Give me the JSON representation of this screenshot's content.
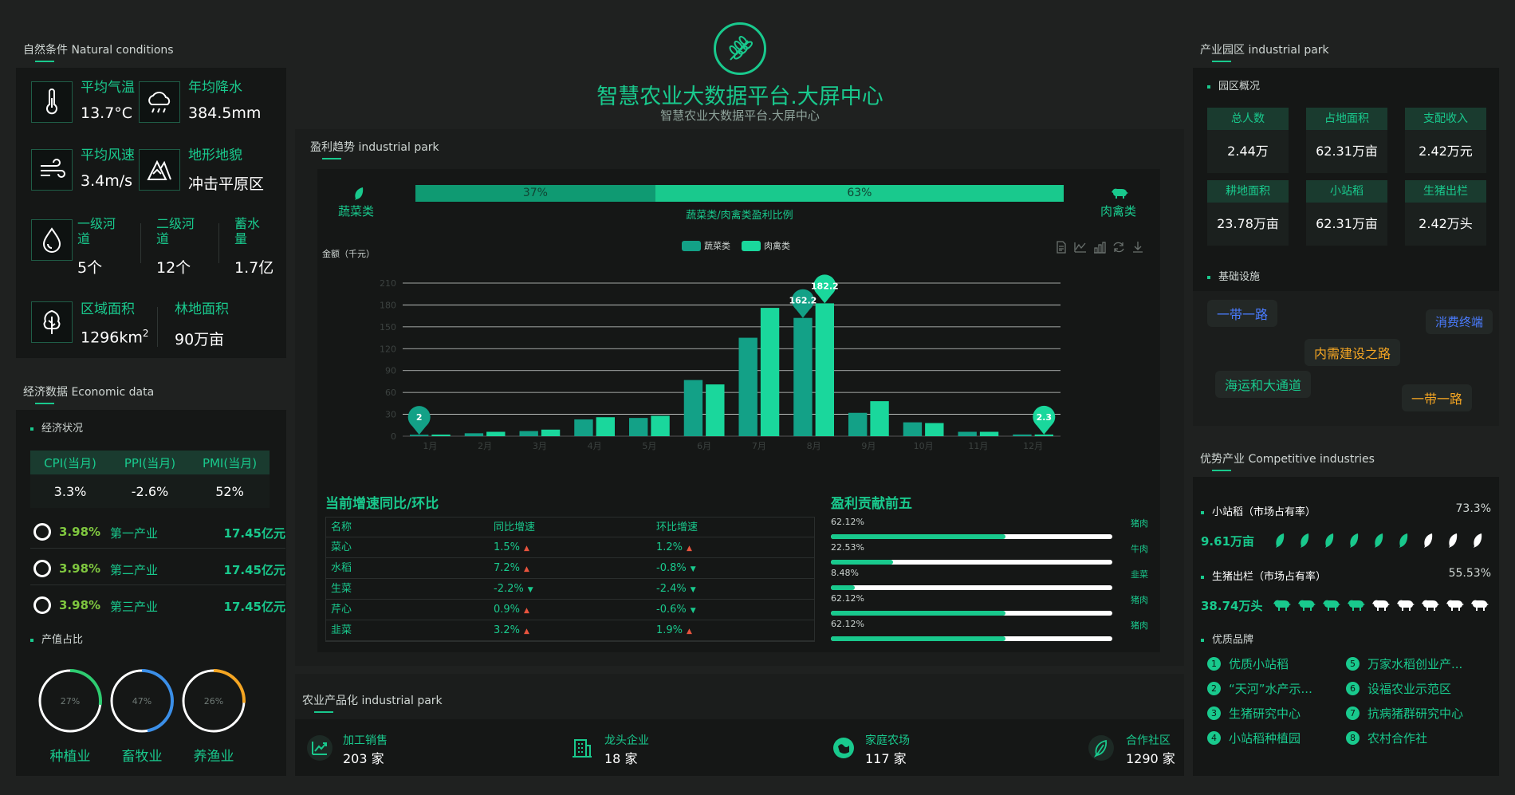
{
  "header": {
    "title": "智慧农业大数据平台.大屏中心",
    "subtitle": "智慧农业大数据平台.大屏中心",
    "logo_icon": "wheat-icon"
  },
  "nature": {
    "title": "自然条件 Natural conditions",
    "temp": {
      "label": "平均气温",
      "value": "13.7°C"
    },
    "rain": {
      "label": "年均降水",
      "value": "384.5mm"
    },
    "wind": {
      "label": "平均风速",
      "value": "3.4m/s"
    },
    "terrain": {
      "label": "地形地貌",
      "value": "冲击平原区"
    },
    "river1": {
      "label": "一级河道",
      "value": "5个"
    },
    "river2": {
      "label": "二级河道",
      "value": "12个"
    },
    "storage": {
      "label": "蓄水量",
      "value": "1.7亿"
    },
    "area": {
      "label": "区域面积",
      "value": "1296km",
      "sup": "2"
    },
    "forest": {
      "label": "林地面积",
      "value": "90万亩"
    }
  },
  "economy": {
    "title": "经济数据 Economic data",
    "status_title": "经济状况",
    "headers": [
      "CPI(当月)",
      "PPI(当月)",
      "PMI(当月)"
    ],
    "values": [
      "3.3%",
      "-2.6%",
      "52%"
    ],
    "rows": [
      {
        "pct": "3.98%",
        "name": "第一产业",
        "value": "17.45亿元"
      },
      {
        "pct": "3.98%",
        "name": "第二产业",
        "value": "17.45亿元"
      },
      {
        "pct": "3.98%",
        "name": "第三产业",
        "value": "17.45亿元"
      }
    ],
    "output_title": "产值占比",
    "donuts": [
      {
        "pct": "27%",
        "fraction": 0.27,
        "label": "种植业",
        "color": "#2ecc71"
      },
      {
        "pct": "47%",
        "fraction": 0.47,
        "label": "畜牧业",
        "color": "#3b8fe8"
      },
      {
        "pct": "26%",
        "fraction": 0.26,
        "label": "养渔业",
        "color": "#f5a623"
      }
    ]
  },
  "profit": {
    "title": "盈利趋势 industrial park",
    "veg_label": "蔬菜类",
    "meat_label": "肉禽类",
    "ratio_left": "37%",
    "ratio_right": "63%",
    "ratio_left_value": 0.37,
    "ratio_caption": "蔬菜类/肉禽类盈利比例",
    "tool_icons": [
      "document-icon",
      "line-chart-icon",
      "bar-chart-icon",
      "refresh-icon",
      "download-icon"
    ]
  },
  "chart_data": {
    "type": "bar",
    "ylabel": "金额（千元）",
    "categories": [
      "1月",
      "2月",
      "3月",
      "4月",
      "5月",
      "6月",
      "7月",
      "8月",
      "9月",
      "10月",
      "11月",
      "12月"
    ],
    "yticks": [
      0,
      30,
      60,
      90,
      120,
      150,
      180,
      210
    ],
    "ylim": [
      0,
      210
    ],
    "series": [
      {
        "name": "蔬菜类",
        "color": "#13a187",
        "values": [
          2,
          4,
          7,
          23,
          25,
          77,
          135,
          162.2,
          32,
          19,
          6,
          2.3
        ]
      },
      {
        "name": "肉禽类",
        "color": "#1ad79c",
        "values": [
          2.2,
          6,
          9,
          26,
          28,
          71,
          176,
          182.2,
          48,
          18,
          6,
          2.3
        ]
      }
    ],
    "pins": [
      {
        "series": 0,
        "index": 0,
        "label": "2"
      },
      {
        "series": 0,
        "index": 7,
        "label": "162.2"
      },
      {
        "series": 1,
        "index": 7,
        "label": "182.2"
      },
      {
        "series": 1,
        "index": 11,
        "label": "2.3"
      }
    ],
    "legend_position": "top-center",
    "grid": true
  },
  "growth": {
    "title": "当前增速同比/环比",
    "headers": [
      "名称",
      "同比增速",
      "环比增速"
    ],
    "rows": [
      {
        "name": "菜心",
        "yoy": "1.5%",
        "yoy_dir": "up",
        "mom": "1.2%",
        "mom_dir": "up"
      },
      {
        "name": "水稻",
        "yoy": "7.2%",
        "yoy_dir": "up",
        "mom": "-0.8%",
        "mom_dir": "down"
      },
      {
        "name": "生菜",
        "yoy": "-2.2%",
        "yoy_dir": "down",
        "mom": "-2.4%",
        "mom_dir": "down"
      },
      {
        "name": "芹心",
        "yoy": "0.9%",
        "yoy_dir": "up",
        "mom": "-0.6%",
        "mom_dir": "down"
      },
      {
        "name": "韭菜",
        "yoy": "3.2%",
        "yoy_dir": "up",
        "mom": "1.9%",
        "mom_dir": "up"
      }
    ]
  },
  "top5": {
    "title": "盈利贡献前五",
    "items": [
      {
        "pct": "62.12%",
        "fraction": 0.62,
        "name": "猪肉"
      },
      {
        "pct": "22.53%",
        "fraction": 0.22,
        "name": "牛肉"
      },
      {
        "pct": "8.48%",
        "fraction": 0.085,
        "name": "韭菜"
      },
      {
        "pct": "62.12%",
        "fraction": 0.62,
        "name": "猪肉"
      },
      {
        "pct": "62.12%",
        "fraction": 0.62,
        "name": "猪肉"
      }
    ]
  },
  "product": {
    "title": "农业产品化 industrial park",
    "items": [
      {
        "label": "加工销售",
        "value": "203 家",
        "icon": "trend-up-icon"
      },
      {
        "label": "龙头企业",
        "value": "18 家",
        "icon": "building-icon"
      },
      {
        "label": "家庭农场",
        "value": "117 家",
        "icon": "farm-icon"
      },
      {
        "label": "合作社区",
        "value": "1290 家",
        "icon": "leaf-icon"
      }
    ]
  },
  "park": {
    "title": "产业园区 industrial park",
    "overview_title": "园区概况",
    "cells": [
      {
        "label": "总人数",
        "value": "2.44万"
      },
      {
        "label": "占地面积",
        "value": "62.31万亩"
      },
      {
        "label": "支配收入",
        "value": "2.42万元"
      },
      {
        "label": "耕地面积",
        "value": "23.78万亩"
      },
      {
        "label": "小站稻",
        "value": "62.31万亩"
      },
      {
        "label": "生猪出栏",
        "value": "2.42万头"
      }
    ],
    "infra_title": "基础设施",
    "tags": [
      {
        "text": "一带一路",
        "color": "#4a7cff"
      },
      {
        "text": "消费终端",
        "color": "#4a7cff"
      },
      {
        "text": "内需建设之路",
        "color": "#f5a623"
      },
      {
        "text": "海运和大通道",
        "color": "#19c98d"
      },
      {
        "text": "一带一路",
        "color": "#f5a623"
      }
    ]
  },
  "competitive": {
    "title": "优势产业 Competitive industries",
    "rice": {
      "label": "小站稻（市场占有率）",
      "pct": "73.3%",
      "amount": "9.61万亩",
      "icon_total": 9,
      "icon_filled": 6
    },
    "pig": {
      "label": "生猪出栏（市场占有率）",
      "pct": "55.53%",
      "amount": "38.74万头",
      "icon_total": 9,
      "icon_filled": 4
    },
    "brands_title": "优质品牌",
    "brands": [
      {
        "num": "1",
        "name": "优质小站稻"
      },
      {
        "num": "5",
        "name": "万家水稻创业产..."
      },
      {
        "num": "2",
        "name": "“天河”水产示..."
      },
      {
        "num": "6",
        "name": "设福农业示范区"
      },
      {
        "num": "3",
        "name": "生猪研究中心"
      },
      {
        "num": "7",
        "name": "抗病猪群研究中心"
      },
      {
        "num": "4",
        "name": "小站稻种植园"
      },
      {
        "num": "8",
        "name": "农村合作社"
      }
    ]
  }
}
